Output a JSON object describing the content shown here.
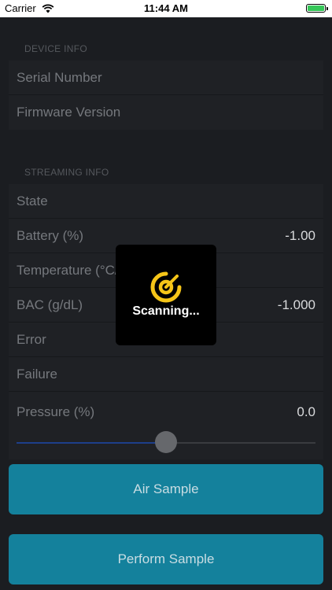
{
  "status_bar": {
    "carrier": "Carrier",
    "time": "11:44 AM"
  },
  "device_info": {
    "header": "DEVICE INFO",
    "rows": [
      {
        "label": "Serial Number",
        "value": ""
      },
      {
        "label": "Firmware Version",
        "value": ""
      }
    ]
  },
  "streaming_info": {
    "header": "STREAMING INFO",
    "rows": [
      {
        "label": "State",
        "value": ""
      },
      {
        "label": "Battery (%)",
        "value": "-1.00"
      },
      {
        "label": "Temperature (°C/°F)",
        "value": ""
      },
      {
        "label": "BAC (g/dL)",
        "value": "-1.000"
      },
      {
        "label": "Error",
        "value": ""
      },
      {
        "label": "Failure",
        "value": ""
      }
    ],
    "pressure": {
      "label": "Pressure (%)",
      "value": "0.0",
      "slider_fraction": 0.5
    }
  },
  "buttons": {
    "air_sample": "Air Sample",
    "perform_sample": "Perform Sample"
  },
  "hud": {
    "text": "Scanning..."
  },
  "colors": {
    "accent_button": "#14819c",
    "hud_icon": "#f5c518",
    "slider_fill": "#1d3f8a"
  }
}
